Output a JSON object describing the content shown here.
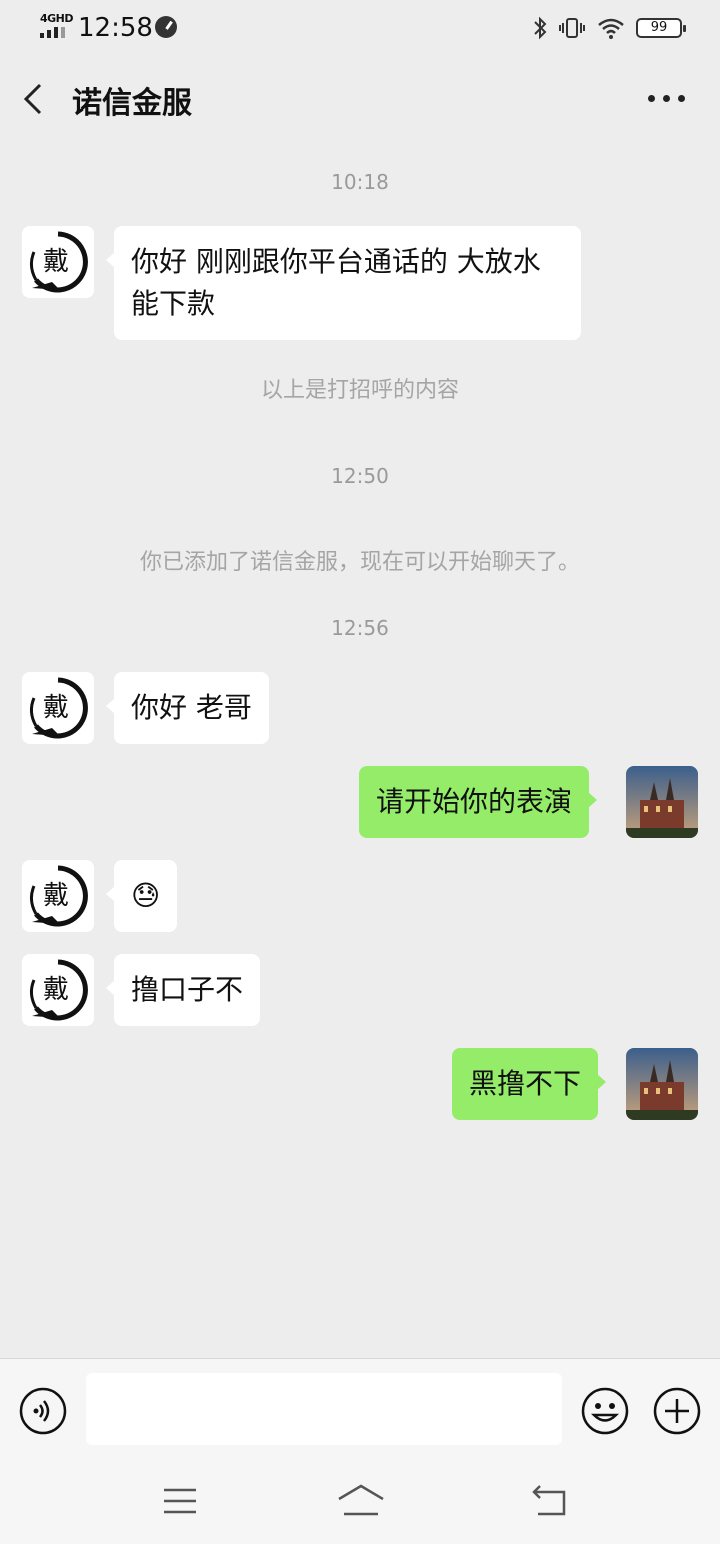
{
  "status_bar": {
    "network": "4GHD",
    "time": "12:58",
    "battery": "99"
  },
  "header": {
    "title": "诺信金服",
    "back_icon": "chevron-left-icon",
    "more_icon": "more-dots-icon"
  },
  "messages": {
    "t1": "10:18",
    "m1": "你好  刚刚跟你平台通话的  大放水  能下款",
    "note1": "以上是打招呼的内容",
    "t2": "12:50",
    "note2": "你已添加了诺信金服，现在可以开始聊天了。",
    "t3": "12:56",
    "m2": "你好  老哥",
    "m3": "请开始你的表演",
    "m4": "😓",
    "m5": "撸口子不",
    "m6": "黑撸不下"
  },
  "input_bar": {
    "value": "",
    "voice_icon": "voice-icon",
    "emoji_icon": "emoji-icon",
    "plus_icon": "plus-icon"
  },
  "colors": {
    "background": "#ededed",
    "sent_bubble": "#95ec69",
    "received_bubble": "#ffffff"
  }
}
